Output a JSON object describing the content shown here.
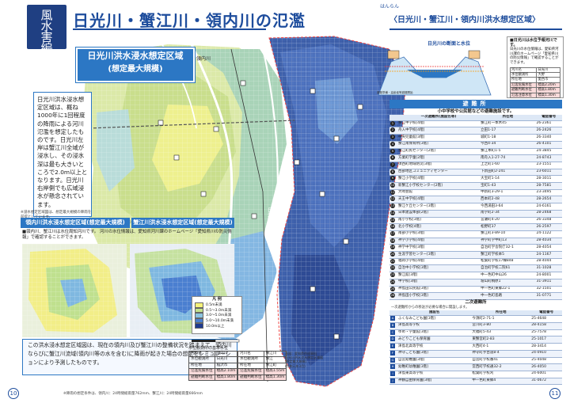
{
  "header": {
    "badge": [
      "風",
      "水",
      "害",
      "編"
    ],
    "title": "日光川・蟹江川・領内川の氾濫",
    "ruby": "はんらん",
    "right_title": "〈日光川・蟹江川・領内川洪水想定区域〉"
  },
  "map": {
    "title1": "日光川洪水浸水想定区域",
    "title2": "(想定最大規模)",
    "river_labels": {
      "ryonai": "領内川",
      "nikko": "日光川",
      "kanie": "蟹江川"
    },
    "copyright": "©2023 ZENRIN CO., LTD.",
    "notes": {
      "left": "基図：愛知県作成資料\n日光川洪水浸水想定区域図\n(想定最大規模)\n(令和元年3月)"
    },
    "legend_title": "凡 例",
    "legend": [
      {
        "label": "0.5m未満",
        "color": "#f6f27a"
      },
      {
        "label": "0.5〜3.0m未満",
        "color": "#c4e28c"
      },
      {
        "label": "3.0〜5.0m未満",
        "color": "#8cc4e0"
      },
      {
        "label": "5.0〜10.0m未満",
        "color": "#4a7fd0"
      },
      {
        "label": "10.0m以上",
        "color": "#1f3a8e"
      }
    ]
  },
  "note_box": "日光川洪水浸水想定区域は、概ね1000年に1回程度の降雨による河川氾濫を想定したものです。日光川左岸は蟹江川全域が浸水し、その浸水深は最も大きいところで2.0m以上となります。日光川右岸側でも広域浸水が懸念されています。",
  "note_small": "※浸水想定区域図は、想定最大規模の降雨を前提としています。",
  "hyogo": {
    "title1": "領内川洪水浸水想定区域(想定最大規模)",
    "title2": "蟹江川洪水浸水想定区域(想定最大規模)",
    "sub": "■領内川、蟹江川は水位周知河川です。\n 河川の水位情報は、愛知県河川課のホームページ「愛知県川の防災情報」で確認することができます。"
  },
  "blue_box": "この洪水浸水想定区域図は、現在の領内川及び蟹江川の整備状況を踏まえて、領内川ならびに蟹江川流域(領内川等の水を含む)に降雨が起きた場合の想定をシミュレーションにより予測したものです。",
  "footnote": "※降雨の想定条件は、領内川：24時間総雨量762mm、蟹江川：24時間総雨量666mm",
  "water_level": {
    "title": "水位観測所の基準水位",
    "t1": {
      "head": [
        "河川名",
        "領内川"
      ],
      "rows": [
        [
          "水位観測所",
          "日光川"
        ],
        [
          "所在地",
          "稲沢市"
        ],
        [
          "氾濫危険水位",
          "標高2.10m"
        ],
        [
          "避難判断水位",
          "標高1.80m"
        ]
      ]
    },
    "t2": {
      "head": [
        "河川名",
        "蟹江川"
      ],
      "rows": [
        [
          "水位観測所",
          "蟹江"
        ],
        [
          "所在地",
          "蟹江町"
        ],
        [
          "氾濫危険水位",
          "標高1.55m"
        ],
        [
          "避難判断水位",
          "標高1.30m"
        ]
      ]
    }
  },
  "diagram": {
    "title": "日光川の断面と水位",
    "labels": [
      "避難準備・高齢者等避難開始",
      "避難勧告",
      "避難指示"
    ]
  },
  "side_info": {
    "title": "■日光川は水位予報河川です。",
    "text": "日光川の水位情報は、愛知県河川課のホームページ「愛知県川の防災情報」で確認することができます。",
    "rows": [
      [
        "河川名",
        "日光川"
      ],
      [
        "水位観測所",
        "大野"
      ],
      [
        "所在地",
        "愛西市"
      ],
      [
        "氾濫危険水位",
        "標高2.20m"
      ],
      [
        "避難判断水位",
        "標高1.80m"
      ],
      [
        "氾濫注意水位",
        "標高1.30m"
      ]
    ]
  },
  "shelter": {
    "head": "避難所",
    "sub": "小中学校や公民館などの避難施設です。",
    "cols1": [
      "一次避難所(施設名等)",
      "所在地",
      "電話番号"
    ],
    "list1": [
      [
        "1",
        "蟹江中学校[4階]",
        "蟹江町一本木45",
        "26-2361"
      ],
      [
        "2",
        "舟入中学校[4階]",
        "立田1-17",
        "26-2426"
      ],
      [
        "3",
        "中央児童館[3階]",
        "城町1-18",
        "26-3340"
      ],
      [
        "4",
        "蟹江南保育所[3階]",
        "今西4-34",
        "26-4101"
      ],
      [
        "5",
        "蟹江町民センター[2階]",
        "蟹江本町1-5",
        "24-3845"
      ],
      [
        "6",
        "方業町学童[2階]",
        "南舟入1-27-74",
        "24-8743"
      ],
      [
        "7",
        "須西町地域防災[3階]",
        "上之町1-60",
        "23-1551"
      ],
      [
        "8",
        "西部地区コミュニティセンター",
        "下新田町2-241",
        "23-6011"
      ],
      [
        "9",
        "蟹江小学校[4階]",
        "大宝町1-14",
        "28-3011"
      ],
      [
        "10",
        "新蟹江小学校センター[2階]",
        "宝町1-43",
        "28-7581"
      ],
      [
        "11",
        "大崎会館",
        "中新町3-29-1",
        "23-3495"
      ],
      [
        "12",
        "天王中学校[4階]",
        "西本町2-48",
        "28-2654"
      ],
      [
        "13",
        "蟹江ケ丘センター[3階]",
        "今西湯田3-64",
        "24-6161"
      ],
      [
        "14",
        "日本建設本部[2階]",
        "南学町2-34",
        "28-2468"
      ],
      [
        "15",
        "南小学校[3階]",
        "宮瀬町4-20",
        "26-3348"
      ],
      [
        "16",
        "北小学校[4階]",
        "松野町37",
        "26-2597"
      ],
      [
        "17",
        "南部小学校[3階]",
        "蟹江町3-89-10",
        "24-1122"
      ],
      [
        "18",
        "神学小学校[4階]",
        "神学町学中町13",
        "28-4034"
      ],
      [
        "19",
        "神学中学校[3階]",
        "自治町学舎院庁32-1",
        "28-4054"
      ],
      [
        "20",
        "生涯学習センター[3階]",
        "蟹江町学校本5",
        "24-1167"
      ],
      [
        "21",
        "福岡小学校[4階]",
        "松葉町学校17棟848",
        "28-4044"
      ],
      [
        "22",
        "自治中小学校[3階]",
        "自治町学校二院61",
        "31-1028"
      ],
      [
        "23",
        "蟹江館[3階]",
        "中一色町中山26",
        "24-8001"
      ],
      [
        "24",
        "中学校[3階]",
        "壇山町桐原1",
        "31-3911"
      ],
      [
        "25",
        "神島田公民館[3階]",
        "中一色町東郷22-1",
        "32-1501"
      ],
      [
        "26",
        "神島田小学校[3階]",
        "中一色町島路",
        "31-0771"
      ]
    ],
    "sub2": "二次避難所",
    "note2": "一次避難所からの移送が必要な場合に開設します。",
    "cols2": [
      "施設名",
      "所在地",
      "電話番号"
    ],
    "list2": [
      [
        "A",
        "ふくなみこども園[3階]",
        "今須町2-71-1",
        "25-4648"
      ],
      [
        "B",
        "津島高等学校",
        "宮川町3-80",
        "28-4158"
      ],
      [
        "C",
        "ゆめ・学童館[3階]",
        "大福町5-43",
        "25-7578"
      ],
      [
        "D",
        "みどりこども保育園",
        "東蟹宮町2-83",
        "25-1017"
      ],
      [
        "E",
        "津島北高等学校",
        "大西町4-1",
        "28-3414"
      ],
      [
        "F",
        "神守こども園[3階]",
        "神守町字古道8-4",
        "24-0910"
      ],
      [
        "G",
        "自宮幼稚園[3階]",
        "自宮町学校番41",
        "25-4048"
      ],
      [
        "H",
        "幼稚町幼稚園[3階]",
        "宮西町学校通32-2",
        "26-4050"
      ],
      [
        "I",
        "津島東高等学校",
        "松葉町学校刈",
        "24-6001"
      ],
      [
        "J",
        "神鶴自由保育園[3階]",
        "中一色町東郷4",
        "31-0672"
      ]
    ]
  },
  "page_numbers": {
    "left": "10",
    "right": "11"
  }
}
